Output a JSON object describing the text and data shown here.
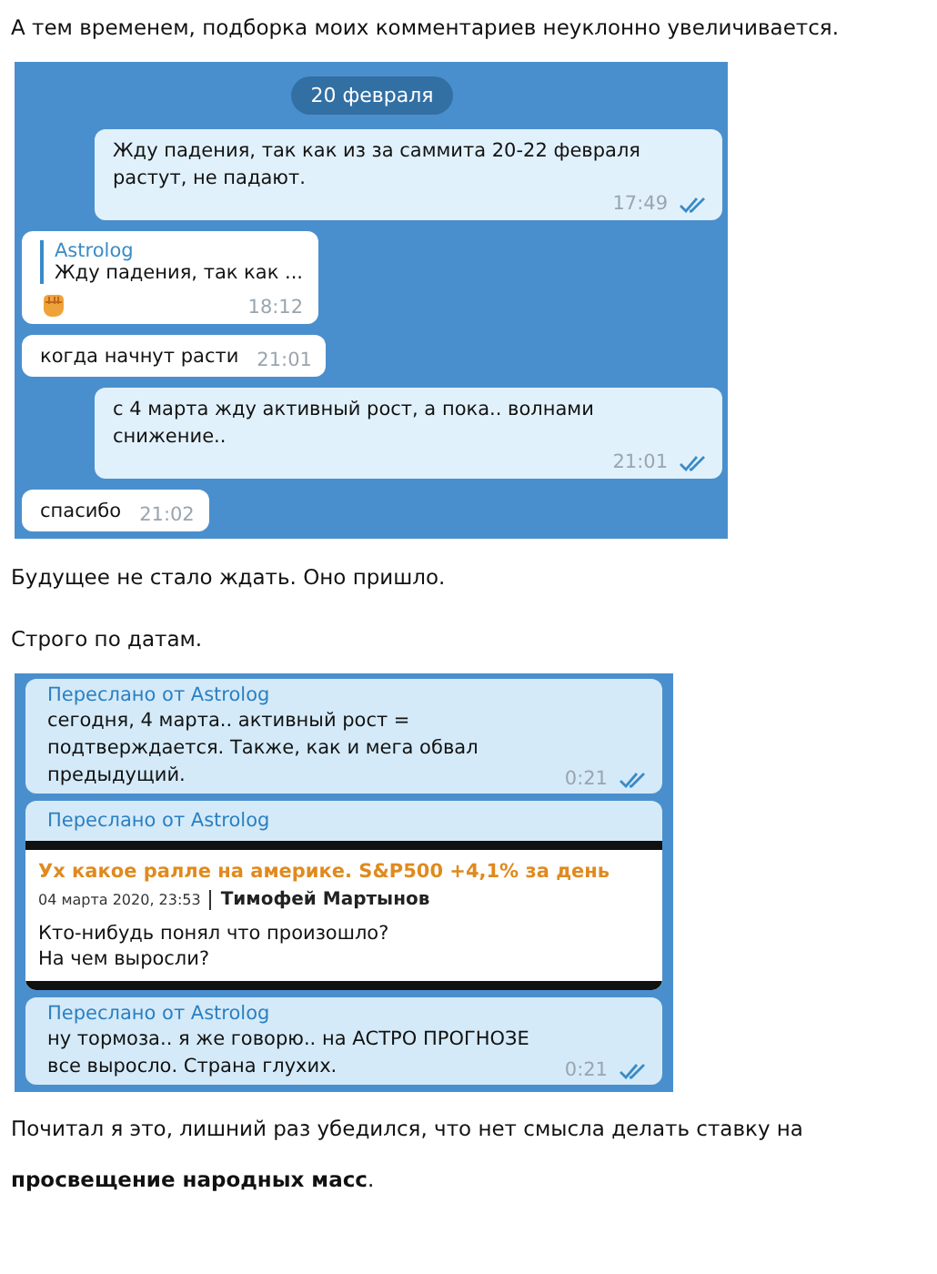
{
  "intro": "А тем временем, подборка моих комментариев неуклонно увеличивается.",
  "chat1": {
    "date": "20 февраля",
    "messages": [
      {
        "kind": "outgoing",
        "text": "Жду падения, так как из за саммита 20-22 февраля растут, не падают.",
        "time": "17:49",
        "read": true
      },
      {
        "kind": "incoming",
        "reply_author": "Astrolog",
        "reply_text": "Жду падения, так как ...",
        "emoji": true,
        "time": "18:12"
      },
      {
        "kind": "incoming",
        "text": "когда начнут расти",
        "time": "21:01"
      },
      {
        "kind": "outgoing",
        "text": "с 4 марта жду активный рост, а пока.. волнами снижение..",
        "time": "21:01",
        "read": true
      },
      {
        "kind": "incoming",
        "text": "спасибо",
        "time": "21:02"
      }
    ]
  },
  "para2": "Будущее не стало ждать. Оно пришло.",
  "para3": "Строго по датам.",
  "chat2": {
    "messages": [
      {
        "kind": "forward",
        "from": "Переслано от Astrolog",
        "text": "сегодня, 4 марта.. активный рост = подтверждается. Также, как и мега обвал предыдущий.",
        "time": "0:21",
        "read": true
      },
      {
        "kind": "forward_card",
        "from": "Переслано от Astrolog",
        "headline": "Ух какое ралле на америке. S&P500 +4,1% за день",
        "date": "04 марта 2020, 23:53",
        "author": "Тимофей Мартынов",
        "body": [
          "Кто-нибудь понял что произошло?",
          "На чем выросли?"
        ]
      },
      {
        "kind": "forward",
        "from": "Переслано от Astrolog",
        "text": "ну тормоза.. я же говорю.. на АСТРО ПРОГНОЗЕ все выросло. Страна глухих.",
        "time": "0:21",
        "read": true
      }
    ]
  },
  "outro": "Почитал я это, лишний раз убедился, что нет смысла делать ставку на **просвещение народных масс**."
}
